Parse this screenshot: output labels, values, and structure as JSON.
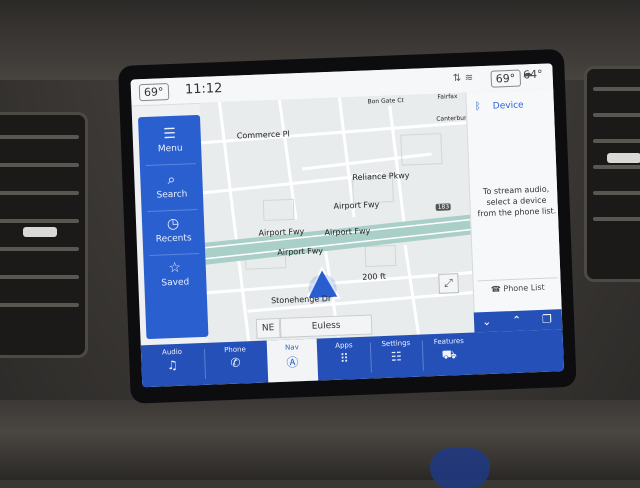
{
  "status_bar": {
    "inside_temp": "69°",
    "time": "11:12",
    "right_temp_box": "69°",
    "outside_temp": "64°",
    "icons": [
      "signal-icon",
      "wifi-icon",
      "cloud-icon"
    ]
  },
  "side_nav": {
    "items": [
      {
        "label": "Menu",
        "icon": "hamburger-icon"
      },
      {
        "label": "Search",
        "icon": "search-icon"
      },
      {
        "label": "Recents",
        "icon": "clock-icon"
      },
      {
        "label": "Saved",
        "icon": "star-icon"
      }
    ]
  },
  "map": {
    "labels": [
      "Commerce Pl",
      "Reliance Pkwy",
      "Airport Fwy",
      "Airport Fwy",
      "Airport Fwy",
      "Airport Fwy",
      "Stonehenge Dr",
      "200 ft",
      "Bon Gate Ct",
      "Fairfax",
      "Canterbury"
    ],
    "route_shield": "183",
    "heading": "NE",
    "city": "Euless",
    "recenter_icon": "expand-icon"
  },
  "device_panel": {
    "title": "Device",
    "message": "To stream audio, select a device from the phone list.",
    "phone_list_button": "Phone List",
    "bluetooth_icon": "bluetooth-icon"
  },
  "bottom_bar": {
    "buttons": [
      {
        "label": "Audio",
        "icon": "music-icon"
      },
      {
        "label": "Phone",
        "icon": "phone-icon"
      },
      {
        "label": "Nav",
        "icon": "nav-icon",
        "active": true
      },
      {
        "label": "Apps",
        "icon": "apps-grid-icon"
      },
      {
        "label": "Settings",
        "icon": "sliders-icon"
      },
      {
        "label": "Features",
        "icon": "car-icon"
      }
    ],
    "controls": [
      "chevron-down-icon",
      "chevron-up-icon",
      "pages-icon"
    ]
  },
  "colors": {
    "accent_blue": "#2a5fd0",
    "bar_blue": "#2450b8",
    "road_teal": "#9ec9c2",
    "screen_bg": "#eef0f1"
  }
}
